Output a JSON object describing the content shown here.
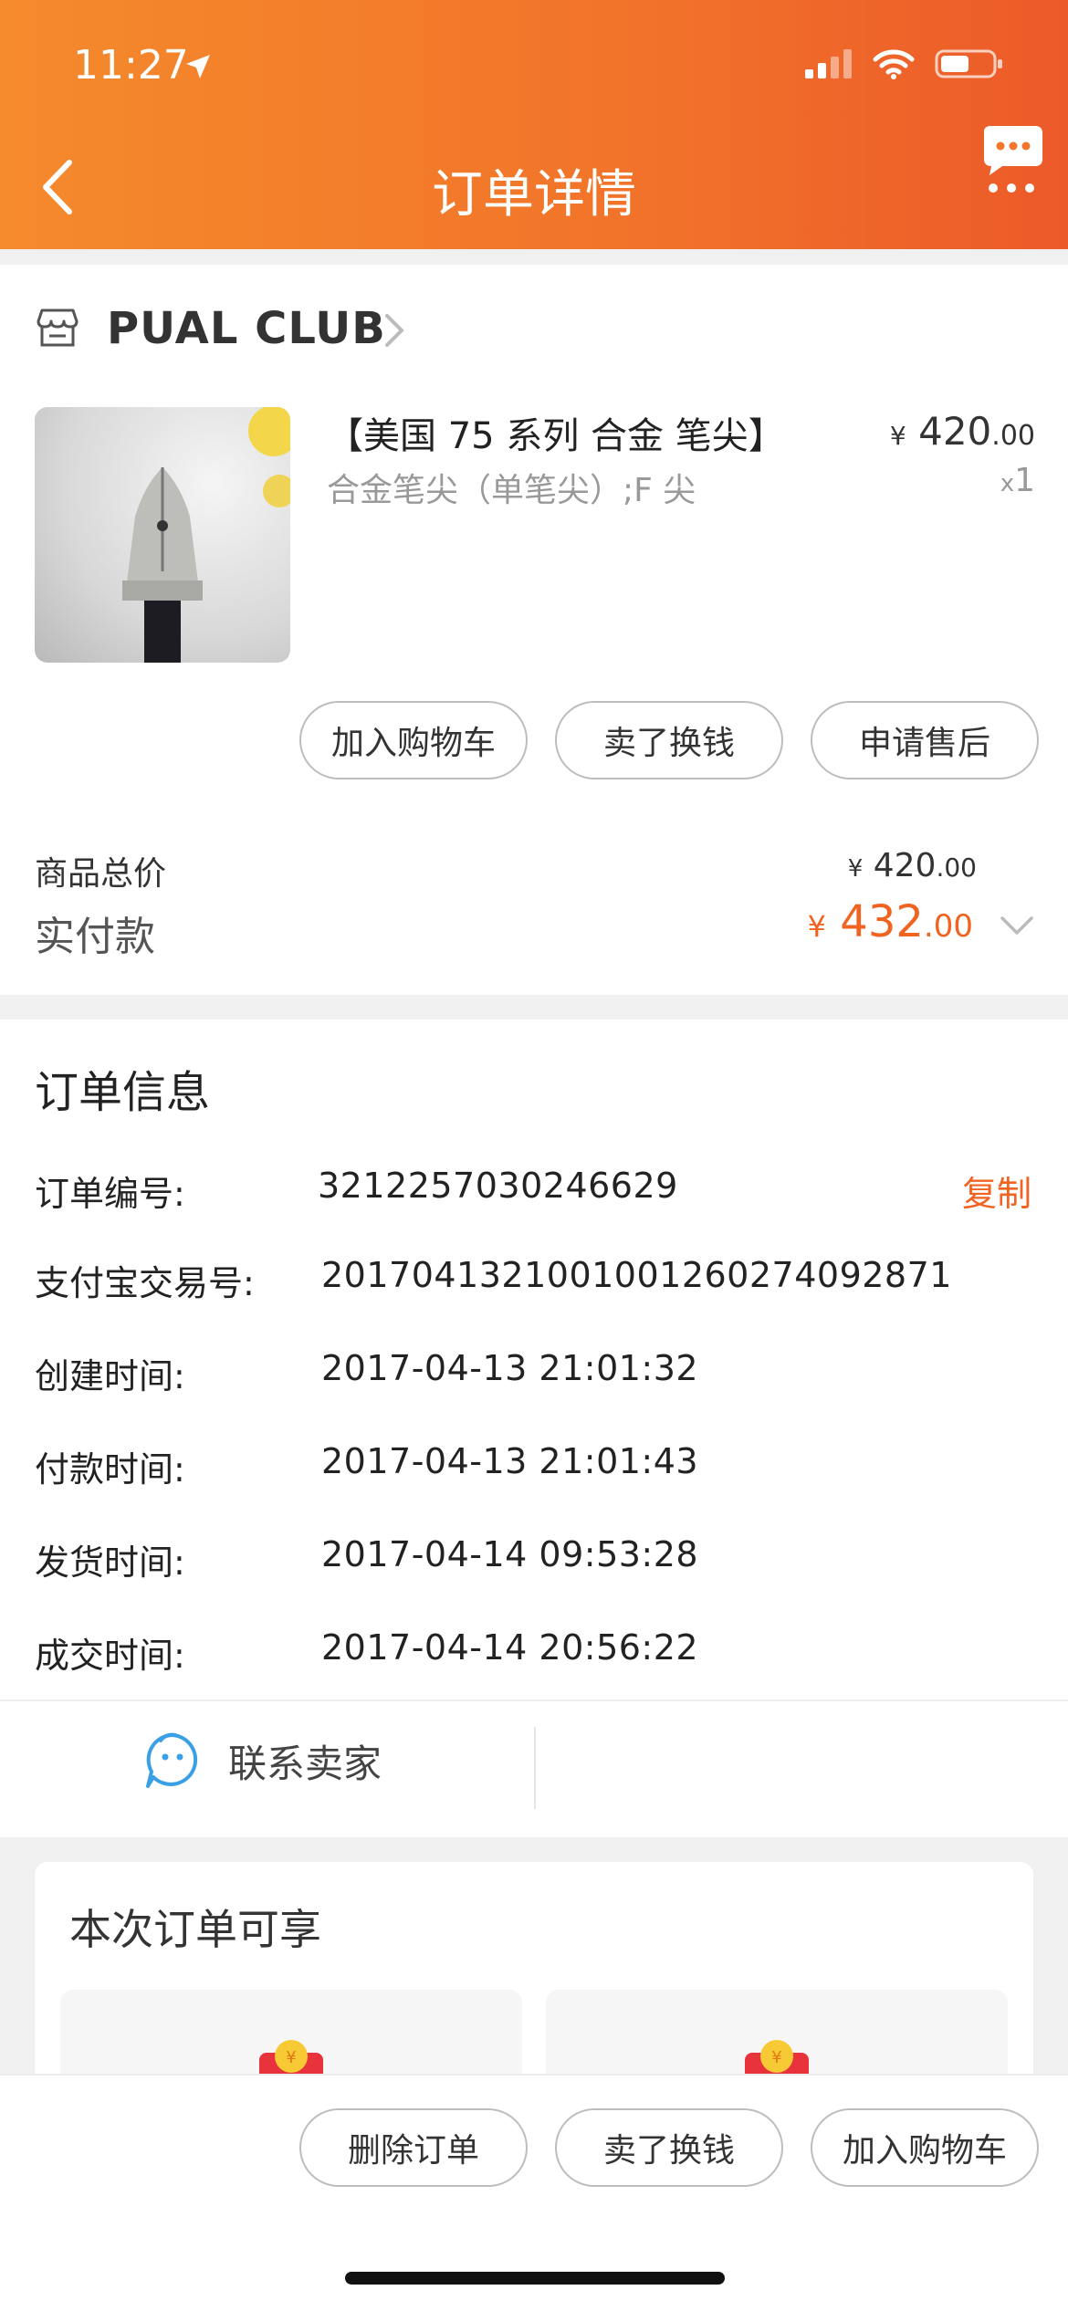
{
  "status_bar": {
    "time": "11:27"
  },
  "nav": {
    "title": "订单详情"
  },
  "store": {
    "name": "PUAL CLUB"
  },
  "product": {
    "title": "【美国 75 系列  合金 笔尖】",
    "sku": "合金笔尖（单笔尖）;F 尖",
    "price_currency": "¥",
    "price_int": "420",
    "price_dec": ".00",
    "qty_prefix": "x",
    "qty": "1"
  },
  "product_actions": [
    "加入购物车",
    "卖了换钱",
    "申请售后"
  ],
  "summary": {
    "goods_total_label": "商品总价",
    "goods_total_currency": "¥",
    "goods_total_int": "420",
    "goods_total_dec": ".00",
    "paid_label": "实付款",
    "paid_currency": "¥",
    "paid_int": "432",
    "paid_dec": ".00"
  },
  "order_info": {
    "title": "订单信息",
    "copy_label": "复制",
    "rows": [
      {
        "label": "订单编号:",
        "value": "3212257030246629"
      },
      {
        "label": "支付宝交易号:",
        "value": "2017041321001001260274092871"
      },
      {
        "label": "创建时间:",
        "value": "2017-04-13 21:01:32"
      },
      {
        "label": "付款时间:",
        "value": "2017-04-13 21:01:43"
      },
      {
        "label": "发货时间:",
        "value": "2017-04-14 09:53:28"
      },
      {
        "label": "成交时间:",
        "value": "2017-04-14 20:56:22"
      }
    ],
    "contact_label": "联系卖家"
  },
  "benefits": {
    "title": "本次订单可享"
  },
  "bottom_actions": [
    "删除订单",
    "卖了换钱",
    "加入购物车"
  ],
  "colors": {
    "accent": "#f06321",
    "header_start": "#f58a2c",
    "header_end": "#ec5a29",
    "link_blue": "#3aa0e6"
  }
}
